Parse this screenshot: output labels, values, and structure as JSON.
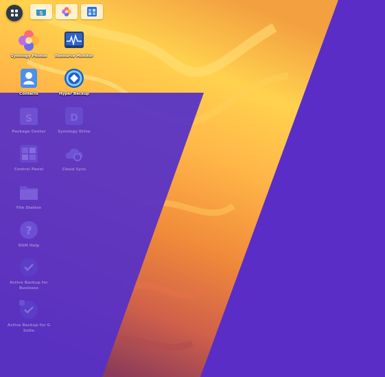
{
  "theme": {
    "violet": "#5b2fc4",
    "violet_overlay": "#5530c8",
    "canyon_light": "#ffd14a",
    "canyon_mid": "#f08a3a",
    "canyon_dark": "#c14a3a",
    "canyon_shadow": "#7a3360"
  },
  "taskbar": {
    "main_menu_icon": "grid-icon",
    "open_apps": [
      {
        "name": "Package Center",
        "icon": "package-center-icon"
      },
      {
        "name": "Synology Photos",
        "icon": "synology-photos-icon"
      },
      {
        "name": "Control Panel",
        "icon": "control-panel-icon"
      }
    ]
  },
  "desktop": {
    "shortcuts": [
      {
        "label": "Synology Photos",
        "icon": "synology-photos-icon"
      },
      {
        "label": "Resource Monitor",
        "icon": "resource-monitor-icon"
      },
      {
        "label": "Contacts",
        "icon": "contacts-icon"
      },
      {
        "label": "Hyper Backup",
        "icon": "hyper-backup-icon"
      },
      {
        "label": "Package Center",
        "icon": "package-center-icon"
      },
      {
        "label": "Synology Drive",
        "icon": "synology-drive-icon"
      },
      {
        "label": "Control Panel",
        "icon": "control-panel-icon"
      },
      {
        "label": "Cloud Sync",
        "icon": "cloud-sync-icon"
      },
      {
        "label": "File Station",
        "icon": "file-station-icon"
      },
      {
        "label": "DSM Help",
        "icon": "help-icon"
      },
      {
        "label": "Active Backup for Business",
        "icon": "active-backup-icon"
      },
      {
        "label": "Active Backup for G Suite",
        "icon": "active-backup-gsuite-icon"
      }
    ]
  }
}
